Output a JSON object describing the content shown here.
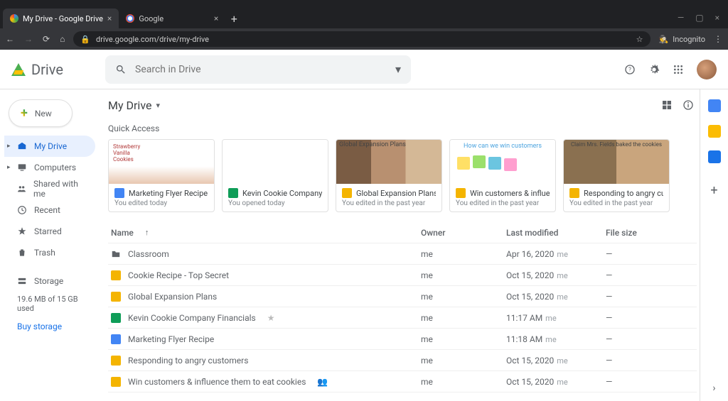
{
  "browser": {
    "tabs": [
      {
        "title": "My Drive - Google Drive",
        "active": true
      },
      {
        "title": "Google",
        "active": false
      }
    ],
    "url": "drive.google.com/drive/my-drive",
    "incognito_label": "Incognito"
  },
  "header": {
    "product": "Drive",
    "search_placeholder": "Search in Drive"
  },
  "sidebar": {
    "new_label": "New",
    "items": [
      {
        "label": "My Drive",
        "icon": "mydrive-icon",
        "active": true,
        "expandable": true
      },
      {
        "label": "Computers",
        "icon": "computers-icon",
        "expandable": true
      },
      {
        "label": "Shared with me",
        "icon": "shared-icon"
      },
      {
        "label": "Recent",
        "icon": "recent-icon"
      },
      {
        "label": "Starred",
        "icon": "starred-icon"
      },
      {
        "label": "Trash",
        "icon": "trash-icon"
      }
    ],
    "storage_label": "Storage",
    "storage_usage": "19.6 MB of 15 GB used",
    "buy_label": "Buy storage"
  },
  "main": {
    "breadcrumb": "My Drive",
    "quick_access_label": "Quick Access",
    "quick_access": [
      {
        "title": "Marketing Flyer Recipe",
        "subtitle": "You edited today",
        "icon": "docs",
        "thumb_caption": "Strawberry Vanilla Cookies"
      },
      {
        "title": "Kevin Cookie Company Financi…",
        "subtitle": "You opened today",
        "icon": "sheets",
        "thumb_caption": ""
      },
      {
        "title": "Global Expansion Plans",
        "subtitle": "You edited in the past year",
        "icon": "slides",
        "thumb_caption": "Global Expansion Plans"
      },
      {
        "title": "Win customers & influence the…",
        "subtitle": "You edited in the past year",
        "icon": "slides",
        "thumb_caption": "How can we win customers"
      },
      {
        "title": "Responding to angry customers",
        "subtitle": "You edited in the past year",
        "icon": "slides",
        "thumb_caption": "Claim Mrs. Fields baked the cookies"
      }
    ],
    "columns": {
      "name": "Name",
      "owner": "Owner",
      "modified": "Last modified",
      "size": "File size"
    },
    "files": [
      {
        "name": "Classroom",
        "icon": "folder",
        "owner": "me",
        "modified": "Apr 16, 2020",
        "mod_by": "me",
        "size": "—"
      },
      {
        "name": "Cookie Recipe - Top Secret",
        "icon": "slides",
        "owner": "me",
        "modified": "Oct 15, 2020",
        "mod_by": "me",
        "size": "—"
      },
      {
        "name": "Global Expansion Plans",
        "icon": "slides",
        "owner": "me",
        "modified": "Oct 15, 2020",
        "mod_by": "me",
        "size": "—"
      },
      {
        "name": "Kevin Cookie Company Financials",
        "icon": "sheets",
        "owner": "me",
        "modified": "11:17 AM",
        "mod_by": "me",
        "size": "—",
        "starred": true
      },
      {
        "name": "Marketing Flyer Recipe",
        "icon": "docs",
        "owner": "me",
        "modified": "11:18 AM",
        "mod_by": "me",
        "size": "—"
      },
      {
        "name": "Responding to angry customers",
        "icon": "slides",
        "owner": "me",
        "modified": "Oct 15, 2020",
        "mod_by": "me",
        "size": "—"
      },
      {
        "name": "Win customers & influence them to eat cookies",
        "icon": "slides",
        "owner": "me",
        "modified": "Oct 15, 2020",
        "mod_by": "me",
        "size": "—",
        "shared": true
      }
    ]
  }
}
